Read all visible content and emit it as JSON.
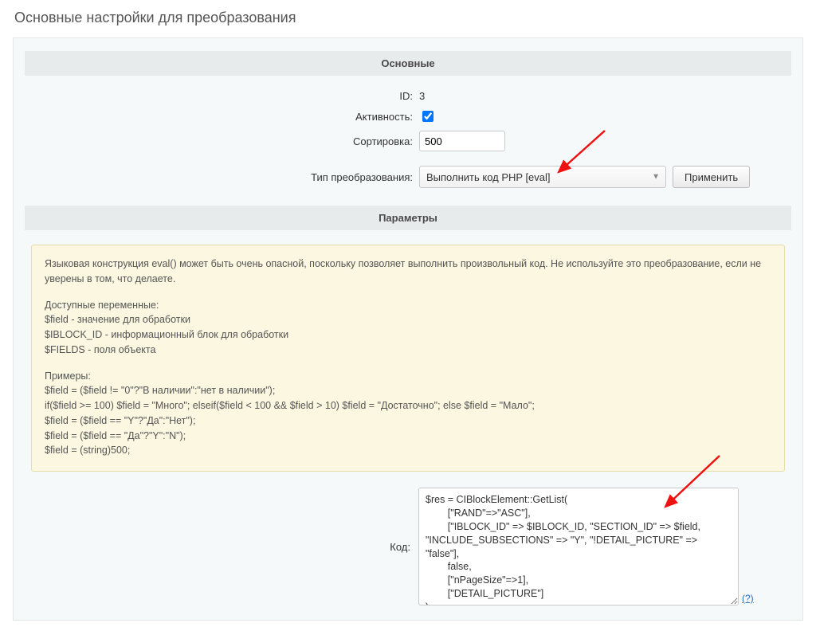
{
  "page": {
    "title": "Основные настройки для преобразования"
  },
  "sections": {
    "main_header": "Основные",
    "params_header": "Параметры"
  },
  "form": {
    "id_label": "ID:",
    "id_value": "3",
    "active_label": "Активность:",
    "active_checked": true,
    "sort_label": "Сортировка:",
    "sort_value": "500",
    "type_label": "Тип преобразования:",
    "type_selected": "Выполнить код PHP [eval]",
    "apply_label": "Применить"
  },
  "warning": {
    "intro": "Языковая конструкция eval() может быть очень опасной, поскольку позволяет выполнить произвольный код. Не используйте это преобразование, если не уверены в том, что делаете.",
    "vars_title": "Доступные переменные:",
    "var1": "$field - значение для обработки",
    "var2": "$IBLOCK_ID - информационный блок для обработки",
    "var3": "$FIELDS - поля объекта",
    "ex_title": "Примеры:",
    "ex1": "$field = ($field != \"0\"?\"В наличии\":\"нет в наличии\");",
    "ex2": "if($field >= 100) $field = \"Много\"; elseif($field < 100 && $field > 10) $field = \"Достаточно\"; else $field = \"Мало\";",
    "ex3": "$field = ($field == \"Y\"?\"Да\":\"Нет\");",
    "ex4": "$field = ($field == \"Да\"?\"Y\":\"N\");",
    "ex5": "$field = (string)500;"
  },
  "code": {
    "label": "Код:",
    "value": "$res = CIBlockElement::GetList(\n        [\"RAND\"=>\"ASC\"],\n        [\"IBLOCK_ID\" => $IBLOCK_ID, \"SECTION_ID\" => $field, \"INCLUDE_SUBSECTIONS\" => \"Y\", \"!DETAIL_PICTURE\" => \"false\"],\n        false,\n        [\"nPageSize\"=>1],\n        [\"DETAIL_PICTURE\"]\n);\nwhile($ob = $res->GetNextElement())",
    "help": "(?)"
  }
}
